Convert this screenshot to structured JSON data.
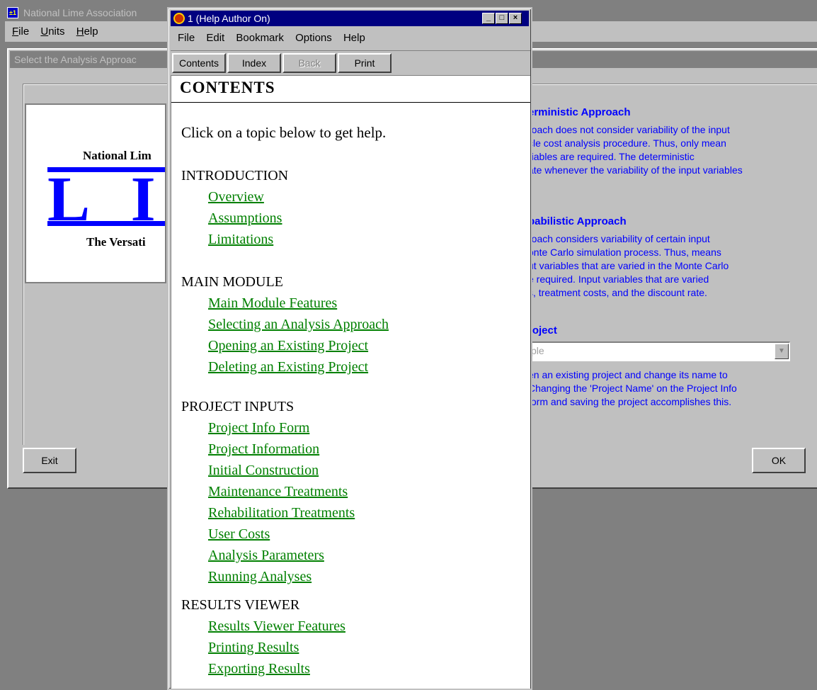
{
  "app": {
    "title": "National Lime Association",
    "menu": [
      "File",
      "Units",
      "Help"
    ]
  },
  "dialog": {
    "title": "Select the Analysis Approac",
    "logo": {
      "top_text": "National Lim",
      "letters": "L I I",
      "bottom_text": "The Versati"
    },
    "deterministic": {
      "heading": "erministic Approach",
      "text": "roach does not consider variability of the input\ncle cost analysis procedure.  Thus, only mean\nriables are required.  The deterministic\nate whenever the variability of the input variables"
    },
    "probabilistic": {
      "heading": "babilistic Approach",
      "text": "roach considers variability of certain input\nonte Carlo simulation process.  Thus, means\nut variables that are varied in the Monte Carlo\ne required.  Input variables that are varied\ns, treatment costs, and the discount rate."
    },
    "project": {
      "heading": "roject",
      "select_value": "ple",
      "note": "en an existing project and change its name to\nChanging the 'Project Name' on the Project Info\n form and saving the project accomplishes this."
    },
    "exit_label": "Exit",
    "ok_label": "OK"
  },
  "help": {
    "title": "1  (Help Author On)",
    "menu": [
      "File",
      "Edit",
      "Bookmark",
      "Options",
      "Help"
    ],
    "toolbar": {
      "contents": "Contents",
      "index": "Index",
      "back": "Back",
      "print": "Print"
    },
    "heading": "CONTENTS",
    "intro": "Click on a topic below to get help.",
    "sections": [
      {
        "title": "INTRODUCTION",
        "topics": [
          "Overview",
          "Assumptions",
          "Limitations"
        ]
      },
      {
        "title": "MAIN MODULE",
        "topics": [
          "Main Module Features",
          "Selecting an Analysis Approach",
          "Opening an Existing Project",
          "Deleting an Existing Project"
        ]
      },
      {
        "title": "PROJECT INPUTS",
        "topics": [
          "Project Info Form",
          "Project Information",
          "Initial Construction",
          "Maintenance Treatments",
          "Rehabilitation Treatments",
          "User Costs",
          "Analysis Parameters",
          "Running Analyses"
        ]
      },
      {
        "title": "RESULTS VIEWER",
        "topics": [
          "Results Viewer Features",
          "Printing Results",
          "Exporting Results"
        ]
      }
    ]
  },
  "colors": {
    "link": "#008000",
    "help_titlebar": "#000080",
    "approach_text": "#0000ff"
  }
}
